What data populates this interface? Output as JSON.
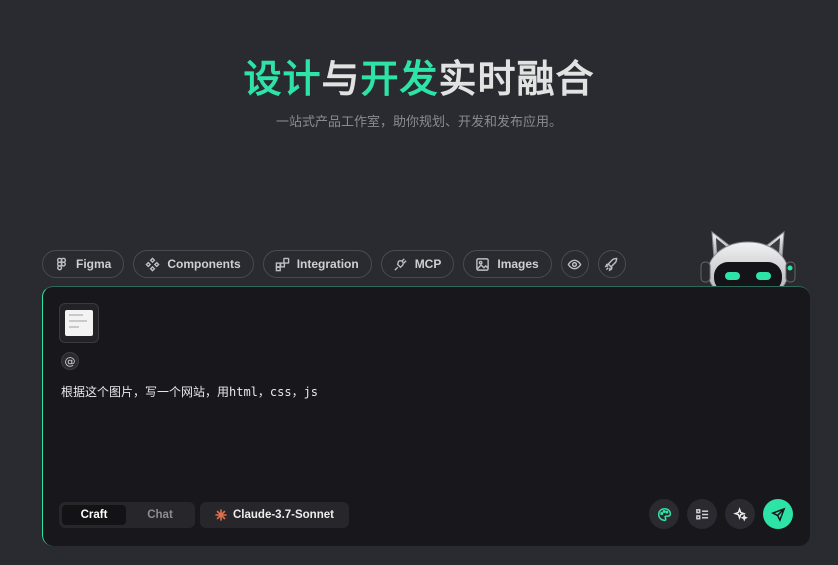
{
  "hero": {
    "title_part1": "设计",
    "title_part2": "与",
    "title_part3": "开发",
    "title_part4": "实时融合",
    "subtitle": "一站式产品工作室，助你规划、开发和发布应用。"
  },
  "chips": [
    {
      "label": "Figma",
      "icon": "figma-icon"
    },
    {
      "label": "Components",
      "icon": "components-icon"
    },
    {
      "label": "Integration",
      "icon": "integration-icon"
    },
    {
      "label": "MCP",
      "icon": "plug-icon"
    },
    {
      "label": "Images",
      "icon": "image-icon"
    }
  ],
  "chip_icons_extra": [
    "eye-icon",
    "rocket-icon"
  ],
  "composer": {
    "mention_symbol": "@",
    "prompt_text": "根据这个图片，写一个网站，用html，css，js",
    "modes": [
      "Craft",
      "Chat"
    ],
    "active_mode": "Craft",
    "model": "Claude-3.7-Sonnet",
    "actions": [
      "palette-icon",
      "checklist-icon",
      "sparkle-icon",
      "send-icon"
    ]
  },
  "colors": {
    "accent": "#2ee3a6",
    "background": "#2a2b30",
    "panel": "#18181c",
    "model_star": "#e0704a"
  }
}
